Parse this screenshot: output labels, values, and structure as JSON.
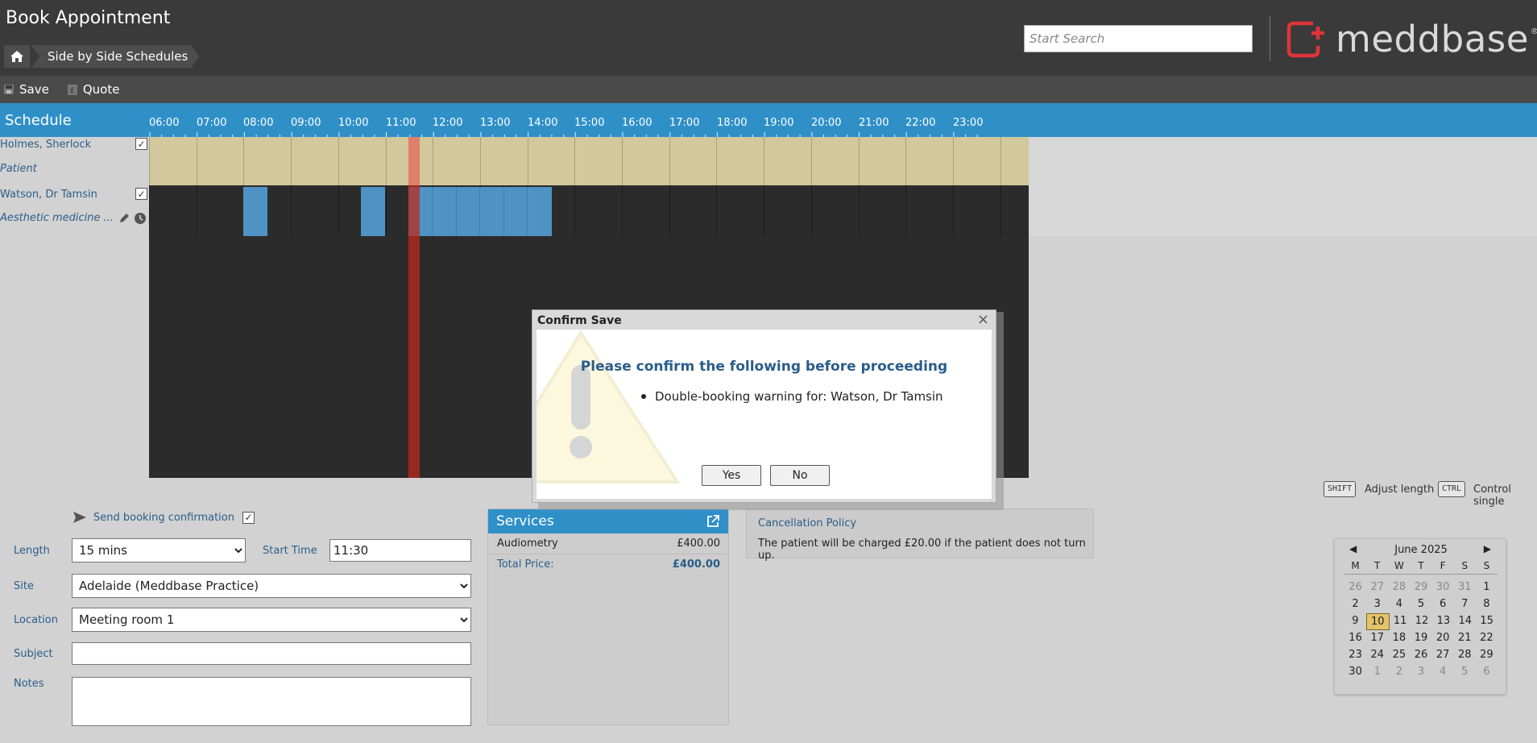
{
  "header": {
    "title": "Book Appointment",
    "breadcrumb": [
      "Side by Side Schedules"
    ],
    "search_placeholder": "Start Search",
    "logo_text": "meddbase",
    "logo_reg": "®"
  },
  "toolbar": {
    "save_label": "Save",
    "quote_label": "Quote"
  },
  "schedule": {
    "title": "Schedule",
    "hours": [
      "06:00",
      "07:00",
      "08:00",
      "09:00",
      "10:00",
      "11:00",
      "12:00",
      "13:00",
      "14:00",
      "15:00",
      "16:00",
      "17:00",
      "18:00",
      "19:00",
      "20:00",
      "21:00",
      "22:00",
      "23:00"
    ],
    "rows": [
      {
        "name": "Holmes, Sherlock",
        "sub": "Patient"
      },
      {
        "name": "Watson, Dr Tamsin",
        "sub": "Aesthetic medicine ..."
      }
    ]
  },
  "keys": {
    "shift_key": "SHIFT",
    "shift_text": "Adjust length",
    "ctrl_key": "CTRL",
    "ctrl_text": "Control single"
  },
  "form": {
    "send_confirmation_label": "Send booking confirmation",
    "length_label": "Length",
    "length_value": "15 mins",
    "start_time_label": "Start Time",
    "start_time_value": "11:30",
    "site_label": "Site",
    "site_value": "Adelaide (Meddbase Practice)",
    "location_label": "Location",
    "location_value": "Meeting room 1",
    "subject_label": "Subject",
    "subject_value": "",
    "notes_label": "Notes",
    "notes_value": ""
  },
  "services": {
    "title": "Services",
    "items": [
      {
        "name": "Audiometry",
        "price": "£400.00"
      }
    ],
    "total_label": "Total Price:",
    "total_value": "£400.00"
  },
  "cancellation": {
    "title": "Cancellation Policy",
    "text": "The patient will be charged £20.00 if the patient does not turn up."
  },
  "calendar": {
    "month": "June 2025",
    "prev": "◀",
    "next": "▶",
    "dow": [
      "M",
      "T",
      "W",
      "T",
      "F",
      "S",
      "S"
    ],
    "weeks": [
      [
        "26",
        "27",
        "28",
        "29",
        "30",
        "31",
        "1"
      ],
      [
        "2",
        "3",
        "4",
        "5",
        "6",
        "7",
        "8"
      ],
      [
        "9",
        "10",
        "11",
        "12",
        "13",
        "14",
        "15"
      ],
      [
        "16",
        "17",
        "18",
        "19",
        "20",
        "21",
        "22"
      ],
      [
        "23",
        "24",
        "25",
        "26",
        "27",
        "28",
        "29"
      ],
      [
        "30",
        "1",
        "2",
        "3",
        "4",
        "5",
        "6"
      ]
    ],
    "today": "10"
  },
  "modal": {
    "title": "Confirm Save",
    "close": "×",
    "heading": "Please confirm the following before proceeding",
    "items": [
      "Double-booking warning for: Watson, Dr Tamsin"
    ],
    "yes_label": "Yes",
    "no_label": "No"
  },
  "colors": {
    "header_bg": "#3a3a3a",
    "schedule_bar": "#2f90c8",
    "patient_row": "#d2c89c",
    "appointment": "#4e93c3",
    "now_line": "#be281e",
    "logo_red": "#e0343a"
  }
}
